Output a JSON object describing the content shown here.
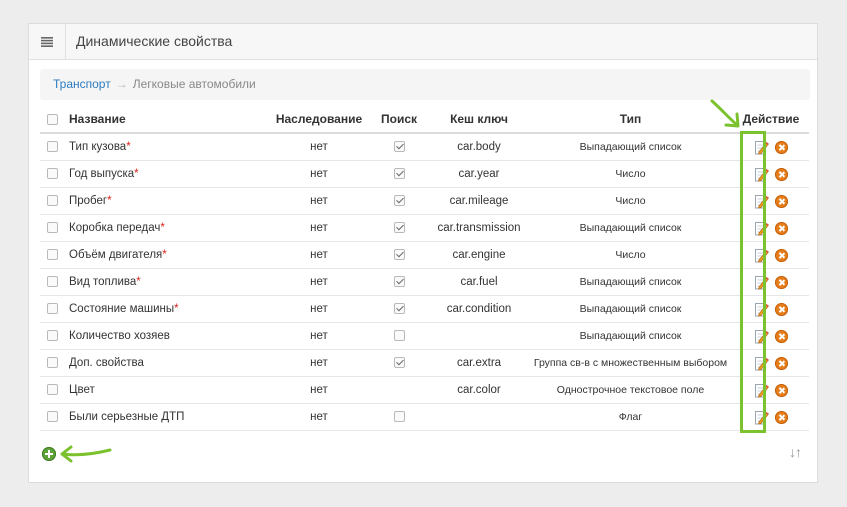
{
  "header": {
    "title": "Динамические свойства",
    "menu_icon": "hamburger-icon"
  },
  "breadcrumb": {
    "parent": "Транспорт",
    "separator": "→",
    "current": "Легковые автомобили"
  },
  "table": {
    "columns": {
      "name": "Название",
      "inherit": "Наследование",
      "search": "Поиск",
      "cache_key": "Кеш ключ",
      "type": "Тип",
      "action": "Действие"
    },
    "rows": [
      {
        "name": "Тип кузова",
        "required": "*",
        "inherit": "нет",
        "search": true,
        "key": "car.body",
        "type": "Выпадающий список"
      },
      {
        "name": "Год выпуска",
        "required": "*",
        "inherit": "нет",
        "search": true,
        "key": "car.year",
        "type": "Число"
      },
      {
        "name": "Пробег",
        "required": "*",
        "inherit": "нет",
        "search": true,
        "key": "car.mileage",
        "type": "Число"
      },
      {
        "name": "Коробка передач",
        "required": "*",
        "inherit": "нет",
        "search": true,
        "key": "car.transmission",
        "type": "Выпадающий список"
      },
      {
        "name": "Объём двигателя",
        "required": "*",
        "inherit": "нет",
        "search": true,
        "key": "car.engine",
        "type": "Число"
      },
      {
        "name": "Вид топлива",
        "required": "*",
        "inherit": "нет",
        "search": true,
        "key": "car.fuel",
        "type": "Выпадающий список"
      },
      {
        "name": "Состояние машины",
        "required": "*",
        "inherit": "нет",
        "search": true,
        "key": "car.condition",
        "type": "Выпадающий список"
      },
      {
        "name": "Количество хозяев",
        "required": "",
        "inherit": "нет",
        "search": false,
        "key": "",
        "type": "Выпадающий список"
      },
      {
        "name": "Доп. свойства",
        "required": "",
        "inherit": "нет",
        "search": true,
        "key": "car.extra",
        "type": "Группа св-в с множественным выбором"
      },
      {
        "name": "Цвет",
        "required": "",
        "inherit": "нет",
        "search": null,
        "key": "car.color",
        "type": "Однострочное текстовое поле"
      },
      {
        "name": "Были серьезные ДТП",
        "required": "",
        "inherit": "нет",
        "search": false,
        "key": "",
        "type": "Флаг"
      }
    ]
  },
  "footer": {
    "sort_label": "↓↑"
  },
  "colors": {
    "accent_green": "#7cc22e",
    "link": "#2b7bbf",
    "delete": "#e67e1b",
    "add": "#5ea33a"
  }
}
